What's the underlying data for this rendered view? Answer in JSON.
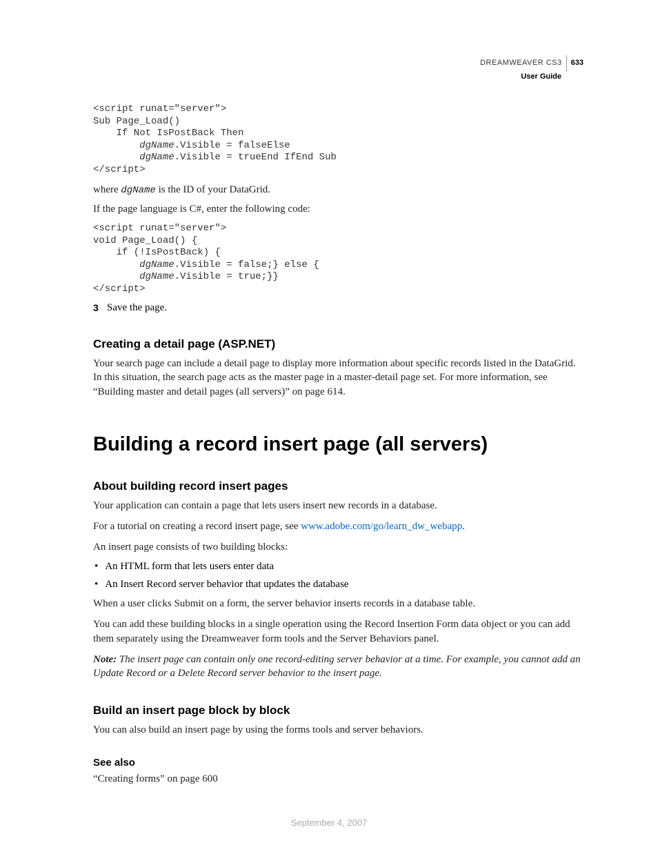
{
  "header": {
    "product": "DREAMWEAVER CS3",
    "page_number": "633",
    "guide": "User Guide"
  },
  "code1": {
    "line1": "<script runat=\"server\">",
    "line2": "Sub Page_Load()",
    "line3": "    If Not IsPostBack Then",
    "line4_pre": "        ",
    "line4_italic": "dgName",
    "line4_post": ".Visible = falseElse",
    "line5_pre": "        ",
    "line5_italic": "dgName",
    "line5_post": ".Visible = trueEnd IfEnd Sub",
    "line6": "</script>"
  },
  "para1_pre": "where ",
  "para1_code": "dgName",
  "para1_post": " is the ID of your DataGrid.",
  "para2": "If the page language is C#, enter the following code:",
  "code2": {
    "line1": "<script runat=\"server\">",
    "line2": "void Page_Load() {",
    "line3": "    if (!IsPostBack) {",
    "line4_pre": "        ",
    "line4_italic": "dgName",
    "line4_post": ".Visible = false;} else {",
    "line5_pre": "        ",
    "line5_italic": "dgName",
    "line5_post": ".Visible = true;}}",
    "line6": "</script>"
  },
  "step3_num": "3",
  "step3_text": "Save the page.",
  "h2_1": "Creating a detail page (ASP.NET)",
  "para3": "Your search page can include a detail page to display more information about specific records listed in the DataGrid. In this situation, the search page acts as the master page in a master-detail page set. For more information, see “Building master and detail pages (all servers)” on page 614.",
  "h1_1": "Building a record insert page (all servers)",
  "h2_2": "About building record insert pages",
  "para4": "Your application can contain a page that lets users insert new records in a database.",
  "para5_pre": "For a tutorial on creating a record insert page, see ",
  "para5_link": "www.adobe.com/go/learn_dw_webapp",
  "para5_post": ".",
  "para6": "An insert page consists of two building blocks:",
  "bullet1": "An HTML form that lets users enter data",
  "bullet2": "An Insert Record server behavior that updates the database",
  "para7": "When a user clicks Submit on a form, the server behavior inserts records in a database table.",
  "para8": "You can add these building blocks in a single operation using the Record Insertion Form data object or you can add them separately using the Dreamweaver form tools and the Server Behaviors panel.",
  "note_label": "Note:",
  "note_text": " The insert page can contain only one record-editing server behavior at a time. For example, you cannot add an Update Record or a Delete Record server behavior to the insert page.",
  "h2_3": "Build an insert page block by block",
  "para9": "You can also build an insert page by using the forms tools and server behaviors.",
  "h3_1": "See also",
  "para10": "“Creating forms” on page 600",
  "footer_date": "September 4, 2007"
}
